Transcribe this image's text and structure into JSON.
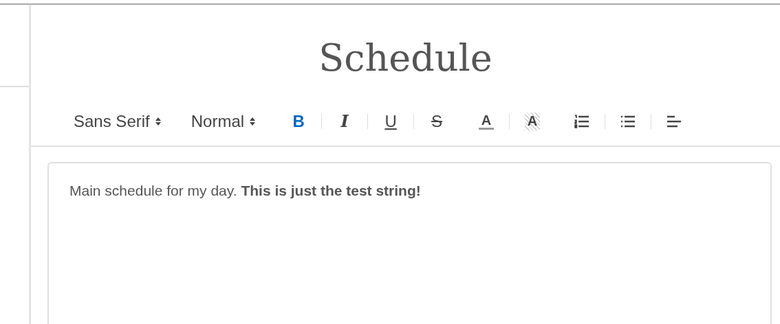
{
  "title": "Schedule",
  "toolbar": {
    "pickers": [
      {
        "kind": "font",
        "value": "Sans Serif"
      },
      {
        "kind": "size",
        "value": "Normal"
      }
    ],
    "groups": [
      [
        {
          "kind": "bold",
          "glyph": "B",
          "selected": true
        },
        {
          "kind": "italic",
          "glyph": "I",
          "selected": false
        },
        {
          "kind": "underline",
          "glyph": "U",
          "selected": false
        },
        {
          "kind": "strike",
          "glyph": "S",
          "selected": false
        }
      ],
      [
        {
          "kind": "color",
          "glyph": "A",
          "selected": false
        },
        {
          "kind": "background",
          "glyph": "A",
          "selected": false
        }
      ],
      [
        {
          "kind": "ordered-list",
          "selected": false
        },
        {
          "kind": "bullet-list",
          "selected": false
        },
        {
          "kind": "align",
          "selected": false
        }
      ]
    ]
  },
  "editor": {
    "text": "Main schedule for my day. **This is just the test string!**"
  }
}
